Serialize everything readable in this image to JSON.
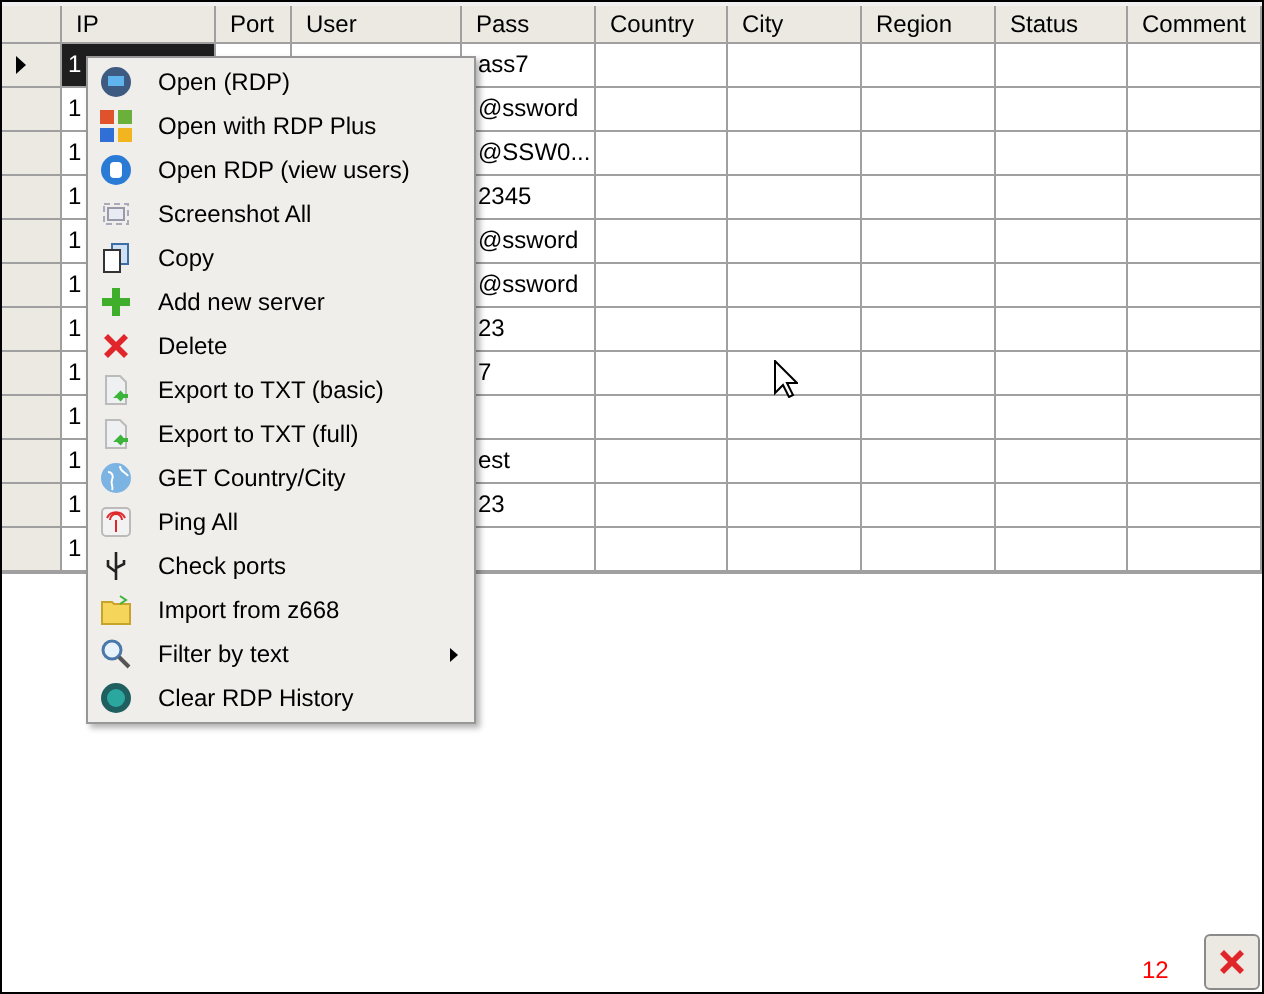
{
  "table": {
    "columns": [
      "IP",
      "Port",
      "User",
      "Pass",
      "Country",
      "City",
      "Region",
      "Status",
      "Comment"
    ],
    "rows": [
      {
        "selected": true,
        "ip": "1",
        "pass": "ass7"
      },
      {
        "selected": false,
        "ip": "1",
        "pass": "@ssword"
      },
      {
        "selected": false,
        "ip": "1",
        "pass": "@SSW0..."
      },
      {
        "selected": false,
        "ip": "1",
        "pass": "2345"
      },
      {
        "selected": false,
        "ip": "1",
        "pass": "@ssword"
      },
      {
        "selected": false,
        "ip": "1",
        "pass": "@ssword"
      },
      {
        "selected": false,
        "ip": "1",
        "pass": "23"
      },
      {
        "selected": false,
        "ip": "1",
        "pass": "7"
      },
      {
        "selected": false,
        "ip": "1",
        "pass": ""
      },
      {
        "selected": false,
        "ip": "1",
        "pass": "est"
      },
      {
        "selected": false,
        "ip": "1",
        "pass": "23"
      },
      {
        "selected": false,
        "ip": "1",
        "pass": ""
      }
    ]
  },
  "context_menu": {
    "items": [
      {
        "kind": "monitor",
        "label": "Open (RDP)"
      },
      {
        "kind": "tiles",
        "label": "Open with RDP Plus"
      },
      {
        "kind": "users",
        "label": "Open RDP (view users)"
      },
      {
        "kind": "screenshot",
        "label": "Screenshot All"
      },
      {
        "kind": "copy",
        "label": "Copy"
      },
      {
        "kind": "plus",
        "label": "Add new server"
      },
      {
        "kind": "delete",
        "label": "Delete"
      },
      {
        "kind": "export",
        "label": "Export to TXT (basic)"
      },
      {
        "kind": "export",
        "label": "Export to TXT (full)"
      },
      {
        "kind": "globe",
        "label": "GET Country/City"
      },
      {
        "kind": "antenna",
        "label": "Ping All"
      },
      {
        "kind": "usb",
        "label": "Check ports"
      },
      {
        "kind": "folder",
        "label": "Import from z668"
      },
      {
        "kind": "search",
        "label": "Filter by text",
        "submenu": true
      },
      {
        "kind": "history",
        "label": "Clear RDP History"
      }
    ]
  },
  "count": "12"
}
